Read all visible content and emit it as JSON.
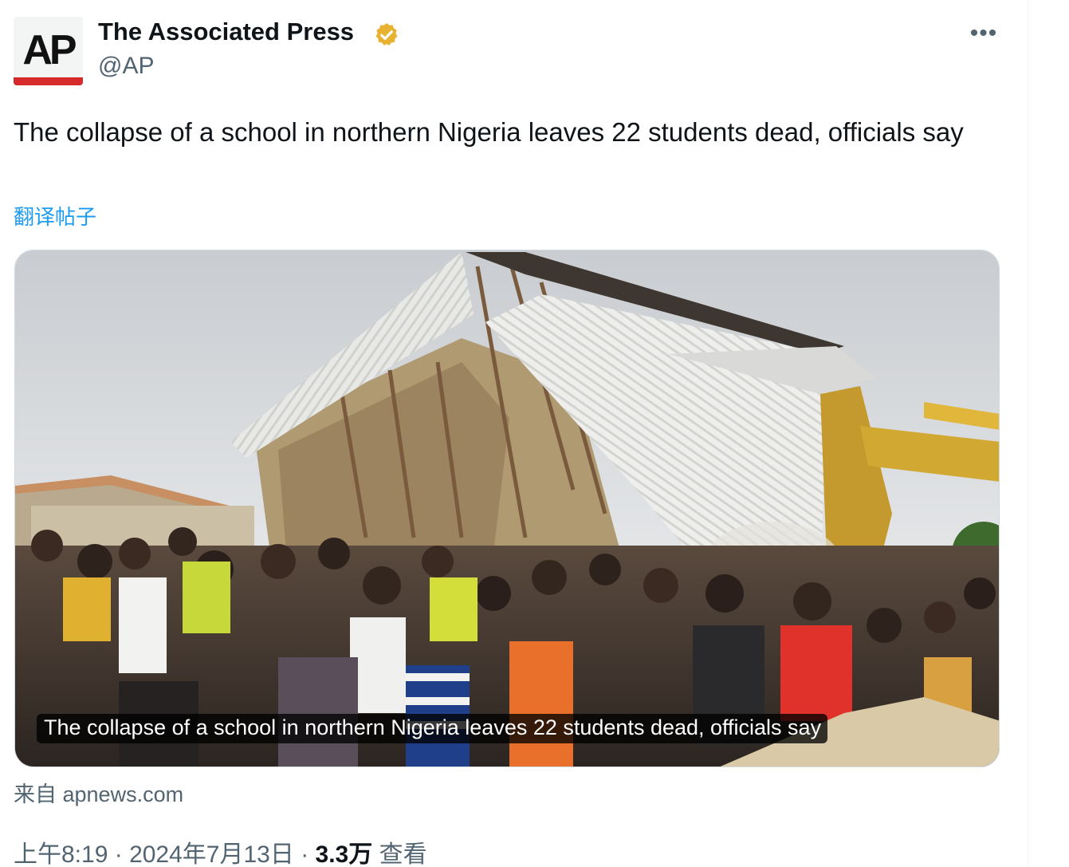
{
  "author": {
    "display_name": "The Associated Press",
    "handle": "@AP",
    "avatar_text": "AP",
    "verified_color": "#e8b12f"
  },
  "tweet": {
    "text": "The collapse of a school in northern Nigeria leaves 22 students dead, officials say",
    "translate_label": "翻译帖子"
  },
  "card": {
    "image_description": "collapsed-school-building-with-crowd",
    "caption": "The collapse of a school in northern Nigeria leaves 22 students dead, officials say",
    "source": "来自 apnews.com"
  },
  "meta": {
    "time": "上午8:19",
    "sep1": " · ",
    "date": "2024年7月13日",
    "sep2": " · ",
    "views_count": "3.3万",
    "views_label": " 查看"
  },
  "icons": {
    "more": "more-icon"
  },
  "colors": {
    "link": "#1d9bf0",
    "secondary": "#536471",
    "primary": "#0f1419"
  }
}
